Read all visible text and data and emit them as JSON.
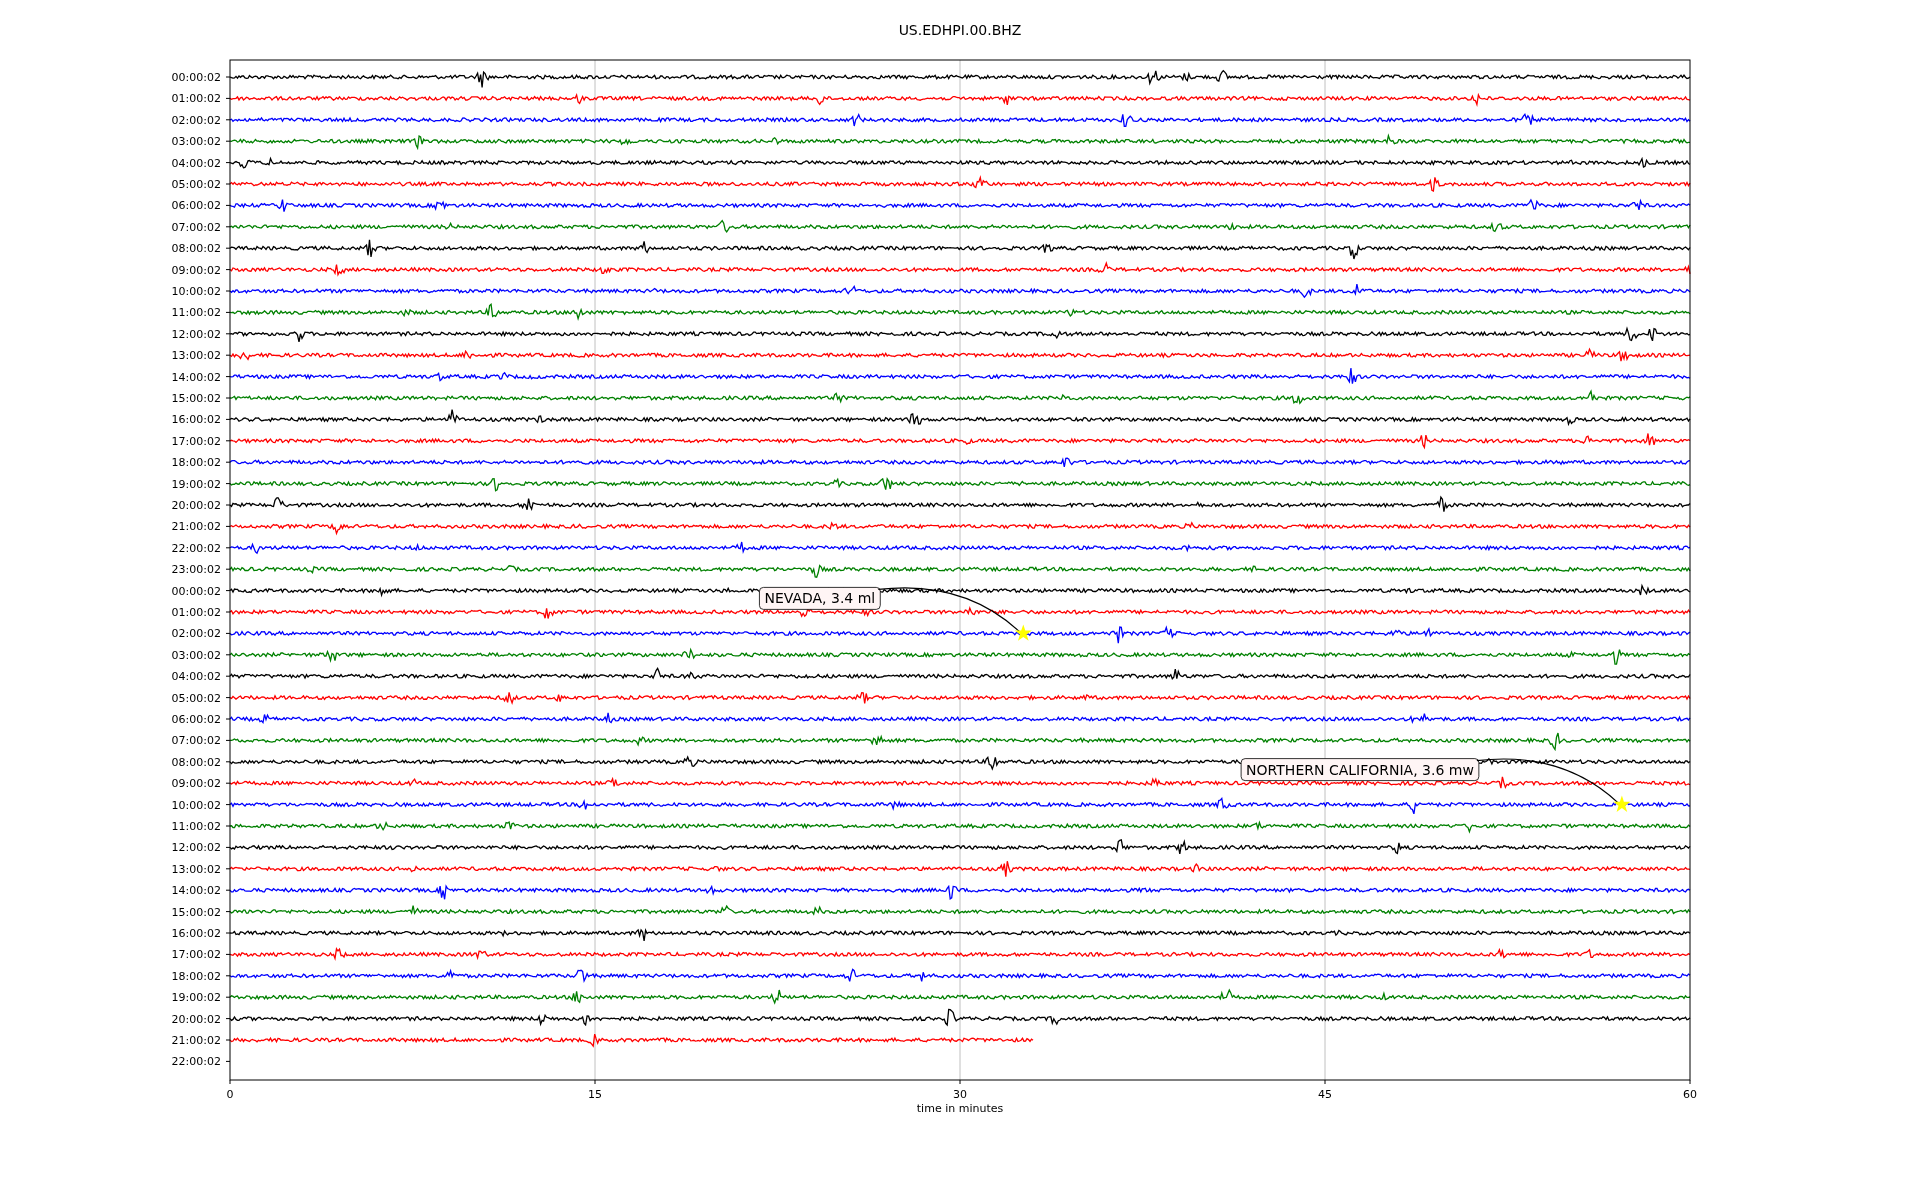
{
  "plot": {
    "title": "US.EDHPI.00.BHZ",
    "xlabel": "time in minutes",
    "xticks": [
      "0",
      "15",
      "30",
      "45",
      "60"
    ],
    "rows": [
      {
        "label": "00:00:02",
        "color": "#000000",
        "level": 1
      },
      {
        "label": "01:00:02",
        "color": "#ff0000",
        "level": 1
      },
      {
        "label": "02:00:02",
        "color": "#0000ff",
        "level": 1
      },
      {
        "label": "03:00:02",
        "color": "#008000",
        "level": 1
      },
      {
        "label": "04:00:02",
        "color": "#000000",
        "level": 1
      },
      {
        "label": "05:00:02",
        "color": "#ff0000",
        "level": 1
      },
      {
        "label": "06:00:02",
        "color": "#0000ff",
        "level": 1
      },
      {
        "label": "07:00:02",
        "color": "#008000",
        "level": 1
      },
      {
        "label": "08:00:02",
        "color": "#000000",
        "level": 1
      },
      {
        "label": "09:00:02",
        "color": "#ff0000",
        "level": 1
      },
      {
        "label": "10:00:02",
        "color": "#0000ff",
        "level": 1
      },
      {
        "label": "11:00:02",
        "color": "#008000",
        "level": 1
      },
      {
        "label": "12:00:02",
        "color": "#000000",
        "level": 1
      },
      {
        "label": "13:00:02",
        "color": "#ff0000",
        "level": 1
      },
      {
        "label": "14:00:02",
        "color": "#0000ff",
        "level": 1
      },
      {
        "label": "15:00:02",
        "color": "#008000",
        "level": 1
      },
      {
        "label": "16:00:02",
        "color": "#000000",
        "level": 1
      },
      {
        "label": "17:00:02",
        "color": "#ff0000",
        "level": 1
      },
      {
        "label": "18:00:02",
        "color": "#0000ff",
        "level": 1
      },
      {
        "label": "19:00:02",
        "color": "#008000",
        "level": 1
      },
      {
        "label": "20:00:02",
        "color": "#000000",
        "level": 1
      },
      {
        "label": "21:00:02",
        "color": "#ff0000",
        "level": 1
      },
      {
        "label": "22:00:02",
        "color": "#0000ff",
        "level": 1
      },
      {
        "label": "23:00:02",
        "color": "#008000",
        "level": 1
      },
      {
        "label": "00:00:02",
        "color": "#000000",
        "level": 1
      },
      {
        "label": "01:00:02",
        "color": "#ff0000",
        "level": 1
      },
      {
        "label": "02:00:02",
        "color": "#0000ff",
        "level": 1,
        "event": "NEVADA, 3.4 ml"
      },
      {
        "label": "03:00:02",
        "color": "#008000",
        "level": 1
      },
      {
        "label": "04:00:02",
        "color": "#000000",
        "level": 1
      },
      {
        "label": "05:00:02",
        "color": "#ff0000",
        "level": 1
      },
      {
        "label": "06:00:02",
        "color": "#0000ff",
        "level": 1
      },
      {
        "label": "07:00:02",
        "color": "#008000",
        "level": 1
      },
      {
        "label": "08:00:02",
        "color": "#000000",
        "level": 1
      },
      {
        "label": "09:00:02",
        "color": "#ff0000",
        "level": 1
      },
      {
        "label": "10:00:02",
        "color": "#0000ff",
        "level": 1,
        "event": "NORTHERN CALIFORNIA, 3.6 mw"
      },
      {
        "label": "11:00:02",
        "color": "#008000",
        "level": 1
      },
      {
        "label": "12:00:02",
        "color": "#000000",
        "level": 1
      },
      {
        "label": "13:00:02",
        "color": "#ff0000",
        "level": 1
      },
      {
        "label": "14:00:02",
        "color": "#0000ff",
        "level": 1
      },
      {
        "label": "15:00:02",
        "color": "#008000",
        "level": 1
      },
      {
        "label": "16:00:02",
        "color": "#000000",
        "level": 1
      },
      {
        "label": "17:00:02",
        "color": "#ff0000",
        "level": 1
      },
      {
        "label": "18:00:02",
        "color": "#0000ff",
        "level": 1
      },
      {
        "label": "19:00:02",
        "color": "#008000",
        "level": 1
      },
      {
        "label": "20:00:02",
        "color": "#000000",
        "level": 1
      },
      {
        "label": "21:00:02",
        "color": "#ff0000",
        "level": 0.55
      },
      {
        "label": "22:00:02"
      }
    ]
  }
}
